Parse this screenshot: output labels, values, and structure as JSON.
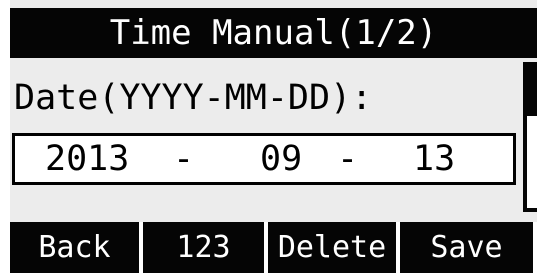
{
  "header": {
    "title": "Time Manual(1/2)"
  },
  "form": {
    "date_label": "Date(YYYY-MM-DD):",
    "date": {
      "year": "2013",
      "separator": "-",
      "month": "09",
      "day": "13"
    }
  },
  "softkeys": {
    "back": "Back",
    "input_mode": "123",
    "delete": "Delete",
    "save": "Save"
  }
}
